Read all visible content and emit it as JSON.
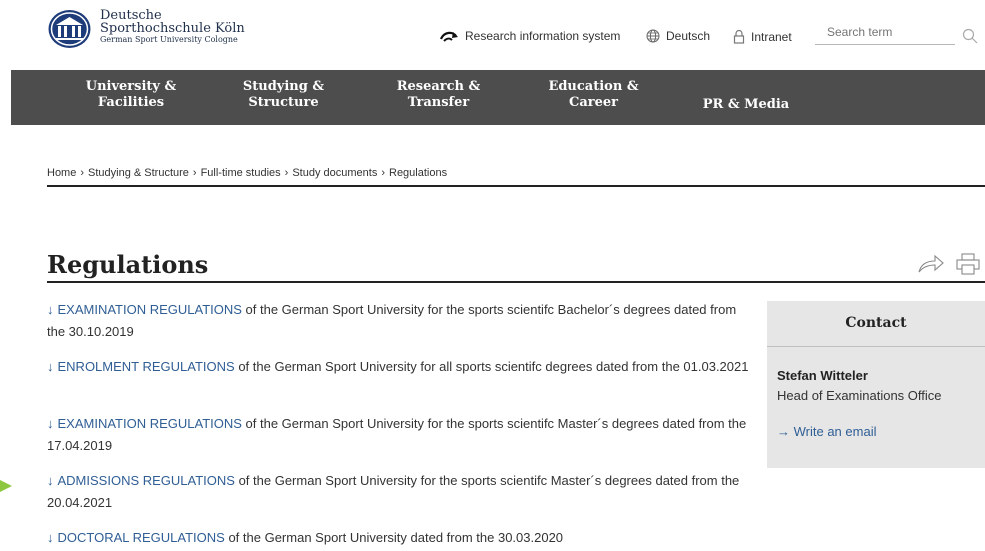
{
  "header": {
    "brand_line1": "Deutsche",
    "brand_line2": "Sporthochschule Köln",
    "brand_line3": "German Sport University Cologne",
    "research_link": "Research information system",
    "language_link": "Deutsch",
    "intranet_link": "Intranet",
    "search_placeholder": "Search term"
  },
  "nav": [
    {
      "line1": "University &",
      "line2": "Facilities"
    },
    {
      "line1": "Studying &",
      "line2": "Structure"
    },
    {
      "line1": "Research &",
      "line2": "Transfer"
    },
    {
      "line1": "Education &",
      "line2": "Career"
    },
    {
      "line1": "PR & Media",
      "line2": ""
    }
  ],
  "breadcrumb": [
    "Home",
    "Studying & Structure",
    "Full-time studies",
    "Study documents",
    "Regulations"
  ],
  "breadcrumb_separator": "›",
  "page_title": "Regulations",
  "regulations": [
    {
      "arrow": "↓",
      "link": "EXAMINATION REGULATIONS",
      "text": " of the German Sport University for the sports scientifc Bachelor´s degrees dated from the 30.10.2019"
    },
    {
      "arrow": "↓",
      "link": "ENROLMENT REGULATIONS",
      "text": " of the German Sport University for all sports scientifc degrees dated from the 01.03.2021"
    },
    {
      "arrow": "↓",
      "link": "EXAMINATION REGULATIONS",
      "text": " of the German Sport University for the sports scientifc Master´s degrees dated from the 17.04.2019"
    },
    {
      "arrow": "↓",
      "link": "ADMISSIONS REGULATIONS",
      "text": " of the German Sport University for the sports scientifc Master´s degrees dated from the 20.04.2021"
    },
    {
      "arrow": "↓",
      "link": "DOCTORAL REGULATIONS",
      "text": " of the German Sport University dated from the 30.03.2020"
    }
  ],
  "contact": {
    "heading": "Contact",
    "name": "Stefan Witteler",
    "role": "Head of Examinations Office",
    "mail_arrow": "→",
    "mail_label": "Write an email"
  },
  "colors": {
    "nav_bg": "#4d4d4d",
    "link": "#2f5e95",
    "brand_blue": "#1f3c7a",
    "contact_bg": "#e6e6e6",
    "pointer": "#8dc63f"
  }
}
